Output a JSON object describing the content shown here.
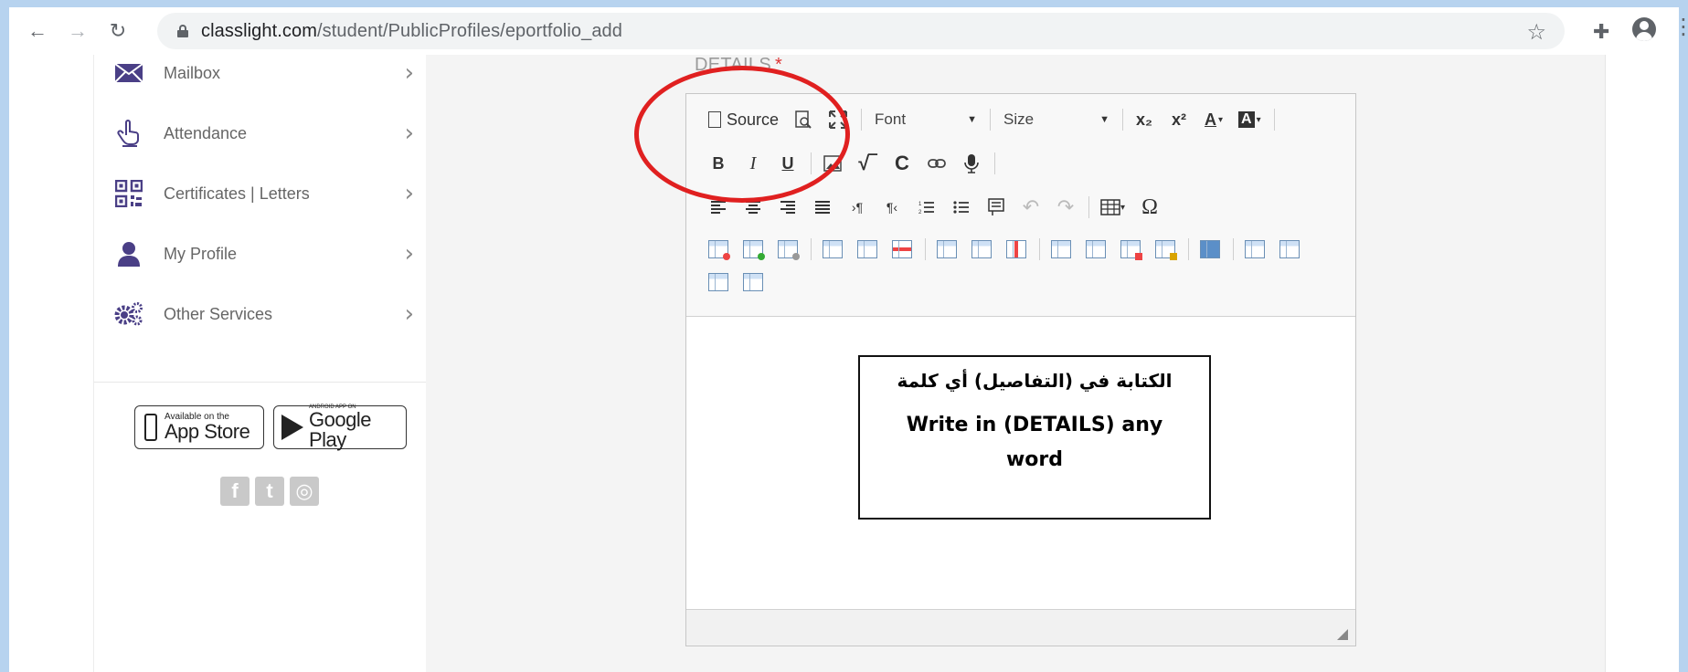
{
  "browser": {
    "url_domain": "classlight.com",
    "url_path": "/student/PublicProfiles/eportfolio_add",
    "back_icon": "arrow-left-icon",
    "forward_icon": "arrow-right-icon",
    "reload_icon": "reload-icon"
  },
  "sidebar": {
    "items": [
      {
        "label": "Mailbox",
        "icon": "envelope-icon"
      },
      {
        "label": "Attendance",
        "icon": "hand-pointer-icon"
      },
      {
        "label": "Certificates | Letters",
        "icon": "qr-code-icon"
      },
      {
        "label": "My Profile",
        "icon": "user-icon"
      },
      {
        "label": "Other Services",
        "icon": "gears-icon"
      }
    ],
    "app_store": {
      "small": "Available on the",
      "big": "App Store"
    },
    "google_play": {
      "small": "ANDROID APP ON",
      "big": "Google Play"
    },
    "social": [
      "f",
      "t",
      "◎"
    ]
  },
  "form": {
    "details_label": "DETAILS",
    "required_mark": "*"
  },
  "toolbar": {
    "source_label": "Source",
    "font_label": "Font",
    "size_label": "Size",
    "subscript": "x₂",
    "superscript": "x²",
    "text_color": "A",
    "bg_color": "A",
    "bold": "B",
    "italic": "I",
    "underline": "U",
    "special_char": "Ω",
    "undo": "↶",
    "redo": "↷"
  },
  "editor": {
    "note_arabic": "الكتابة في (التفاصيل) أي كلمة",
    "note_english": "Write in  (DETAILS) any word"
  },
  "colors": {
    "frame": "#b7d3ef",
    "sidebar_icon": "#4a3f86",
    "annotation_red": "#e02020",
    "content_bg": "#f4f4f4"
  }
}
